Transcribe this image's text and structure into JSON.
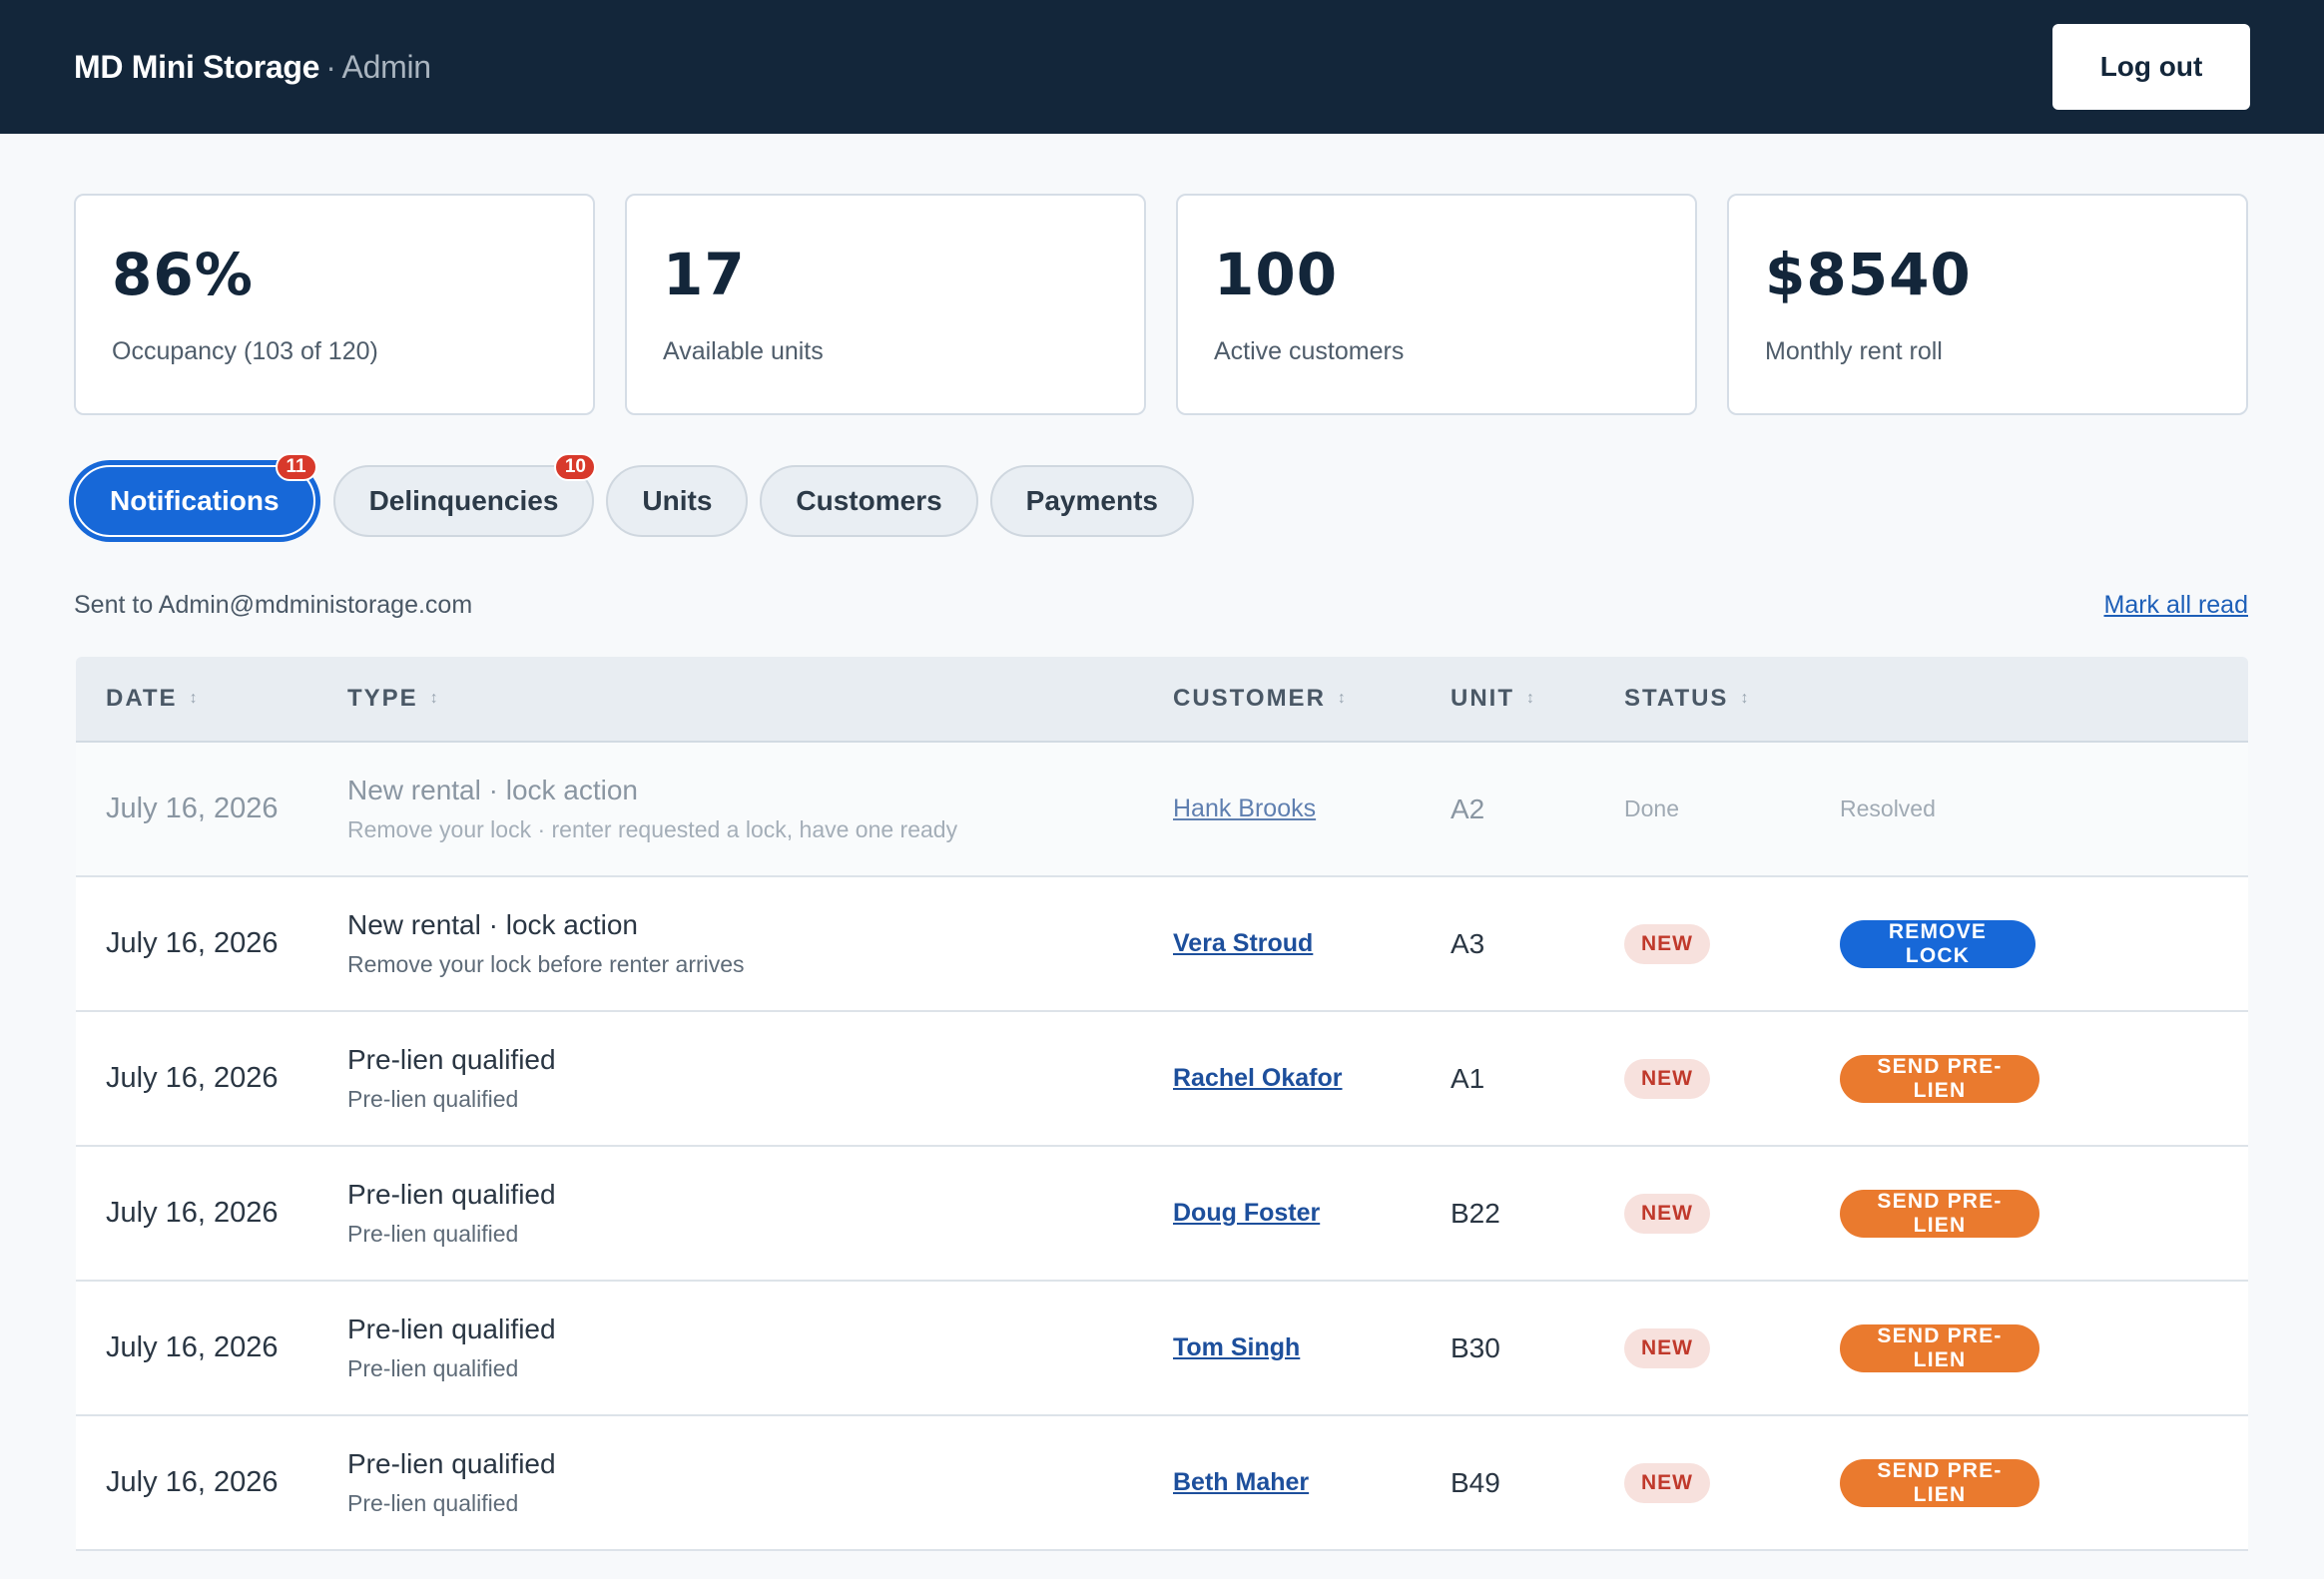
{
  "header": {
    "brand": "MD Mini Storage",
    "separator": "·",
    "role": "Admin",
    "logout_label": "Log out"
  },
  "stats": [
    {
      "value": "86%",
      "label": "Occupancy (103 of 120)"
    },
    {
      "value": "17",
      "label": "Available units"
    },
    {
      "value": "100",
      "label": "Active customers"
    },
    {
      "value": "$8540",
      "label": "Monthly rent roll"
    }
  ],
  "tabs": [
    {
      "label": "Notifications",
      "badge": "11",
      "active": true
    },
    {
      "label": "Delinquencies",
      "badge": "10"
    },
    {
      "label": "Units"
    },
    {
      "label": "Customers"
    },
    {
      "label": "Payments"
    }
  ],
  "subbar": {
    "sent_to": "Sent to Admin@mdministorage.com",
    "mark_all_read": "Mark all read"
  },
  "table": {
    "columns": {
      "date": "DATE",
      "type": "TYPE",
      "customer": "CUSTOMER",
      "unit": "UNIT",
      "status": "STATUS",
      "sort_glyph": "↕"
    },
    "rows": [
      {
        "date": "July 16, 2026",
        "type": "New rental · lock action",
        "detail": "Remove your lock · renter requested a lock, have one ready",
        "customer": "Hank Brooks",
        "unit": "A2",
        "status": "Done",
        "action": "Resolved"
      },
      {
        "date": "July 16, 2026",
        "type": "New rental · lock action",
        "detail": "Remove your lock before renter arrives",
        "customer": "Vera Stroud",
        "unit": "A3",
        "status": "NEW",
        "action": "REMOVE LOCK"
      },
      {
        "date": "July 16, 2026",
        "type": "Pre-lien qualified",
        "detail": "Pre-lien qualified",
        "customer": "Rachel Okafor",
        "unit": "A1",
        "status": "NEW",
        "action": "SEND PRE-LIEN"
      },
      {
        "date": "July 16, 2026",
        "type": "Pre-lien qualified",
        "detail": "Pre-lien qualified",
        "customer": "Doug Foster",
        "unit": "B22",
        "status": "NEW",
        "action": "SEND PRE-LIEN"
      },
      {
        "date": "July 16, 2026",
        "type": "Pre-lien qualified",
        "detail": "Pre-lien qualified",
        "customer": "Tom Singh",
        "unit": "B30",
        "status": "NEW",
        "action": "SEND PRE-LIEN"
      },
      {
        "date": "July 16, 2026",
        "type": "Pre-lien qualified",
        "detail": "Pre-lien qualified",
        "customer": "Beth Maher",
        "unit": "B49",
        "status": "NEW",
        "action": "SEND PRE-LIEN"
      }
    ]
  },
  "colors": {
    "header_bg": "#13263a",
    "primary_blue": "#1768d8",
    "action_orange": "#ea7a2e",
    "badge_red": "#d8392b",
    "new_pill_bg": "#f7e1dd"
  }
}
